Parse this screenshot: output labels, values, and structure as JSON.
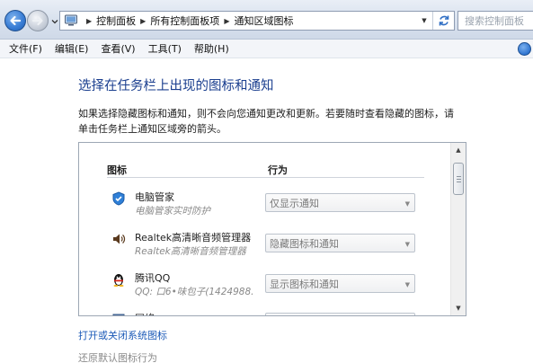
{
  "window": {
    "breadcrumbs": [
      "控制面板",
      "所有控制面板项",
      "通知区域图标"
    ],
    "search_placeholder": "搜索控制面板"
  },
  "menu": [
    "文件(F)",
    "编辑(E)",
    "查看(V)",
    "工具(T)",
    "帮助(H)"
  ],
  "main": {
    "title": "选择在任务栏上出现的图标和通知",
    "description_line1": "如果选择隐藏图标和通知，则不会向您通知更改和更新。若要随时查看隐藏的图标，请",
    "description_line2": "单击任务栏上通知区域旁的箭头。",
    "columns": {
      "icon": "图标",
      "behavior": "行为"
    },
    "rows": [
      {
        "name": "电脑管家",
        "subtitle": "电脑管家实时防护",
        "behavior": "仅显示通知",
        "icon": "shield-icon"
      },
      {
        "name": "Realtek高清晰音频管理器",
        "subtitle": "Realtek高清晰音频管理器",
        "behavior": "隐藏图标和通知",
        "icon": "speaker-icon"
      },
      {
        "name": "腾讯QQ",
        "subtitle": "QQ: 口6•味包子(1424988...",
        "behavior": "显示图标和通知",
        "icon": "qq-penguin-icon"
      },
      {
        "name": "网络",
        "subtitle": "",
        "behavior": "",
        "icon": "network-icon"
      }
    ],
    "links": {
      "system_icons": "打开或关闭系统图标",
      "restore_defaults": "还原默认图标行为"
    }
  },
  "colors": {
    "title_blue": "#1b3f8f",
    "link_blue": "#1d5bb8",
    "disabled_gray": "#8a8a8a"
  }
}
